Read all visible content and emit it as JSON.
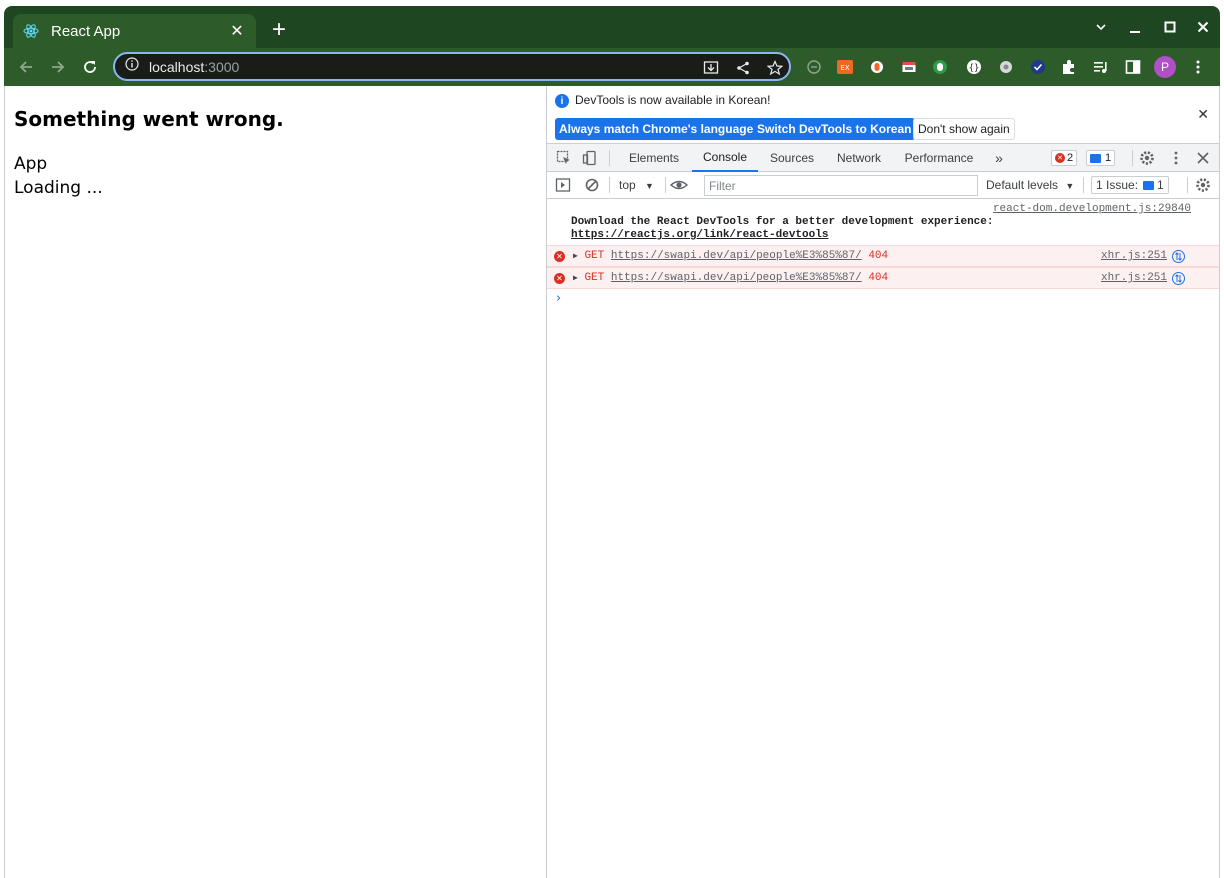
{
  "browser": {
    "tab_title": "React App",
    "url_host": "localhost",
    "url_port": ":3000",
    "profile_initial": "P",
    "accent": "#8ab4f8",
    "frame_color": "#1e4620"
  },
  "page": {
    "error_title": "Something went wrong.",
    "lines": [
      "App",
      "Loading ..."
    ]
  },
  "devtools": {
    "infobar": {
      "text": "DevTools is now available in Korean!",
      "btn_match": "Always match Chrome's language",
      "btn_switch": "Switch DevTools to Korean",
      "btn_dont_show": "Don't show again"
    },
    "tabs": [
      "Elements",
      "Console",
      "Sources",
      "Network",
      "Performance"
    ],
    "active_tab": "Console",
    "error_count": "2",
    "message_count": "1",
    "console_bar": {
      "context": "top",
      "filter_placeholder": "Filter",
      "levels": "Default levels",
      "issues_label": "1 Issue:",
      "issues_count": "1"
    },
    "logs": {
      "info_source": "react-dom.development.js:29840",
      "info_text": "Download the React DevTools for a better development experience: ",
      "info_link": "https://reactjs.org/link/react-devtools",
      "errors": [
        {
          "method": "GET",
          "url": "https://swapi.dev/api/people%E3%85%87/",
          "status": "404",
          "source": "xhr.js:251"
        },
        {
          "method": "GET",
          "url": "https://swapi.dev/api/people%E3%85%87/",
          "status": "404",
          "source": "xhr.js:251"
        }
      ]
    }
  }
}
